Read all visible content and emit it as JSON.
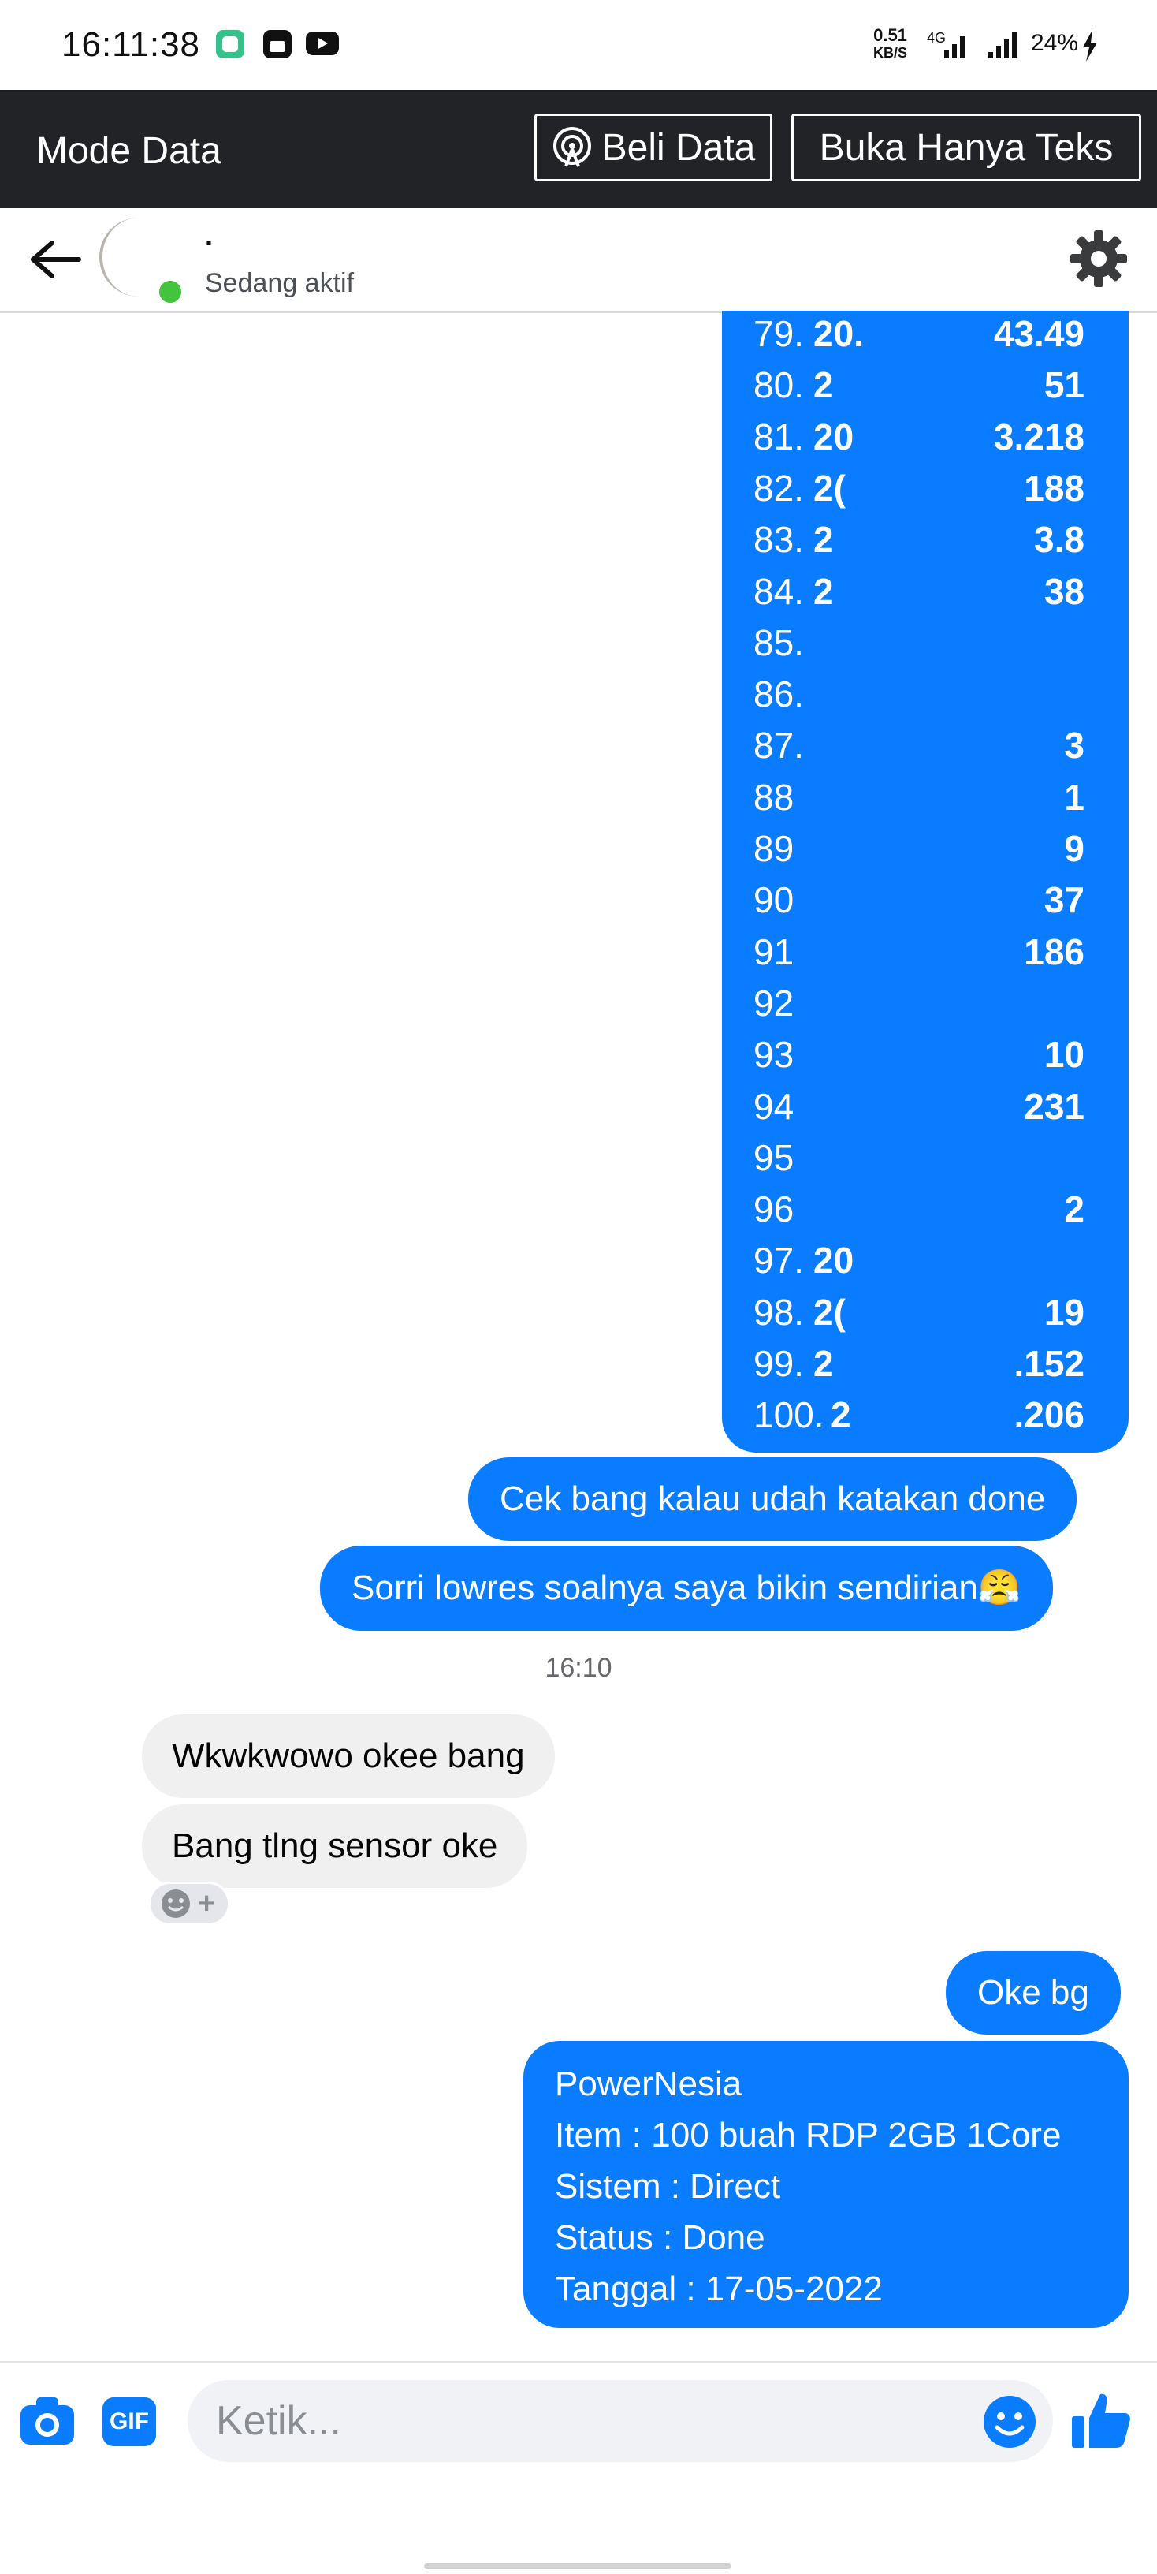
{
  "status_bar": {
    "time": "16:11:38",
    "net_speed_value": "0.51",
    "net_speed_unit": "KB/S",
    "network_type": "4G",
    "battery": "24%"
  },
  "data_mode": {
    "title": "Mode Data",
    "buy_data_label": "Beli Data",
    "text_only_label": "Buka Hanya Teks"
  },
  "chat_header": {
    "contact_name": ".",
    "status": "Sedang aktif"
  },
  "ip_list": [
    {
      "num": "79.",
      "left": "20.",
      "right": "43.49"
    },
    {
      "num": "80.",
      "left": "2",
      "right": "51"
    },
    {
      "num": "81.",
      "left": "20",
      "right": "3.218"
    },
    {
      "num": "82.",
      "left": "2(",
      "right": "188"
    },
    {
      "num": "83.",
      "left": "2",
      "right": "3.8"
    },
    {
      "num": "84.",
      "left": "2",
      "right": "38"
    },
    {
      "num": "85.",
      "left": "",
      "right": ""
    },
    {
      "num": "86.",
      "left": "",
      "right": ""
    },
    {
      "num": "87.",
      "left": "",
      "right": "3"
    },
    {
      "num": "88",
      "left": "",
      "right": "1"
    },
    {
      "num": "89",
      "left": "",
      "right": "9"
    },
    {
      "num": "90",
      "left": "",
      "right": "37"
    },
    {
      "num": "91",
      "left": "",
      "right": "186"
    },
    {
      "num": "92",
      "left": "",
      "right": ""
    },
    {
      "num": "93",
      "left": "",
      "right": "10"
    },
    {
      "num": "94",
      "left": "",
      "right": "231"
    },
    {
      "num": "95",
      "left": "",
      "right": ""
    },
    {
      "num": "96",
      "left": "",
      "right": "2"
    },
    {
      "num": "97.",
      "left": "20",
      "right": ""
    },
    {
      "num": "98.",
      "left": "2(",
      "right": "19"
    },
    {
      "num": "99.",
      "left": "2",
      "right": ".152"
    },
    {
      "num": "100.",
      "left": "2",
      "right": ".206"
    }
  ],
  "messages": {
    "out1": "Cek bang kalau udah katakan done",
    "out2": "Sorri lowres soalnya saya bikin sendirian😤",
    "timestamp": "16:10",
    "in1": "Wkwkwowo okee bang",
    "in2": "Bang tlng sensor oke",
    "out3": "Oke bg",
    "receipt": [
      "PowerNesia",
      "Item : 100 buah RDP 2GB 1Core",
      "Sistem : Direct",
      "Status : Done",
      "Tanggal : 17-05-2022"
    ]
  },
  "composer": {
    "placeholder": "Ketik...",
    "gif_label": "GIF"
  },
  "colors": {
    "messenger_blue": "#0a7cff",
    "incoming_gray": "#f0f0f0",
    "data_bar": "#212327",
    "online_green": "#44c33c"
  }
}
